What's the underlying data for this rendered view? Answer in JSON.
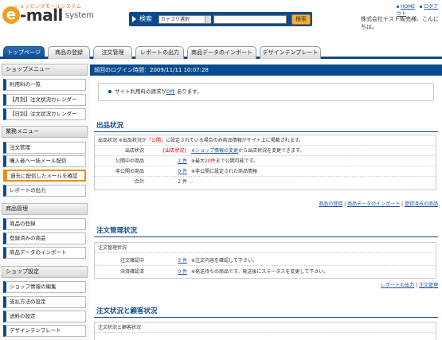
{
  "header": {
    "logo_tagline": "ショッピングモールシステム",
    "logo_e": "e",
    "logo_mall": "-mall",
    "logo_system": "system",
    "search_label": "検索",
    "category_select": "カテゴリ選択",
    "search_input": "",
    "search_button": "検索",
    "help_link": "HOME",
    "logout_link": "ログアウト",
    "welcome": "株式会社テスト販売様、こんにちは。"
  },
  "tabs": [
    {
      "label": "トップページ"
    },
    {
      "label": "商品の登録"
    },
    {
      "label": "注文管理"
    },
    {
      "label": "レポートの出力"
    },
    {
      "label": "商品データのインポート"
    },
    {
      "label": "デザインテンプレート"
    }
  ],
  "sidebar": {
    "sections": [
      {
        "title": "ショップメニュー",
        "items": [
          "利用料の一覧",
          "【月別】注文状況カレンダー",
          "【日別】注文状況カレンダー"
        ]
      },
      {
        "title": "業務メニュー",
        "items": [
          "注文管理",
          "購入者へ一括メール配信",
          "過去に配信したメールを確認",
          "レポートの出力"
        ]
      },
      {
        "title": "商品管理",
        "items": [
          "商品の登録",
          "登録済みの商品",
          "商品データのインポート"
        ]
      },
      {
        "title": "ショップ設定",
        "items": [
          "ショップ情報の編集",
          "支払方法の設定",
          "送料の設定",
          "デザインテンプレート"
        ]
      }
    ]
  },
  "main": {
    "last_login": "前回のログイン時間：2009/11/11 10:07:28",
    "notice_pre": "サイト利用料の請求が",
    "notice_count": "0件",
    "notice_post": "あります。",
    "listing": {
      "title": "出品状況",
      "intro_pre": "出品状況 ※出品状況が",
      "intro_red": "「公開」",
      "intro_post": "に設定されている場合のみ商品情報がサイト上に掲載されます。",
      "rows": [
        {
          "label": "出店状況",
          "value": "[出店状況]",
          "desc_link": "※ショップ情報の変更",
          "desc": "から出店状況を変更できます。"
        },
        {
          "label": "公開中の商品",
          "value": "2 件",
          "desc_pre": "※最大",
          "desc_red": "20件",
          "desc": "まで公開可能です。"
        },
        {
          "label": "非公開の商品",
          "value": "0 件",
          "desc": "※非公開に設定された商品情報"
        },
        {
          "label": "合計",
          "value": "2 件",
          "desc": "-"
        }
      ],
      "footer_links": [
        "商品の登録",
        "商品データのインポート",
        "登録済みの商品"
      ],
      "footer_sep": "|"
    },
    "orders": {
      "title": "注文管理状況",
      "sub": "注文管理状況",
      "rows": [
        {
          "label": "注文確認中",
          "value": "3 件",
          "desc": "※注文内容を確認して下さい。"
        },
        {
          "label": "決済確認済",
          "value": "0 件",
          "desc": "※発送待ちの商品です。発送後にステータスを変更して下さい。"
        }
      ],
      "footer_links": [
        "レポートの出力",
        "注文管理"
      ],
      "footer_sep": "|"
    },
    "customers": {
      "title": "注文状況と顧客状況",
      "sub": "注文状況と顧客状況"
    }
  }
}
